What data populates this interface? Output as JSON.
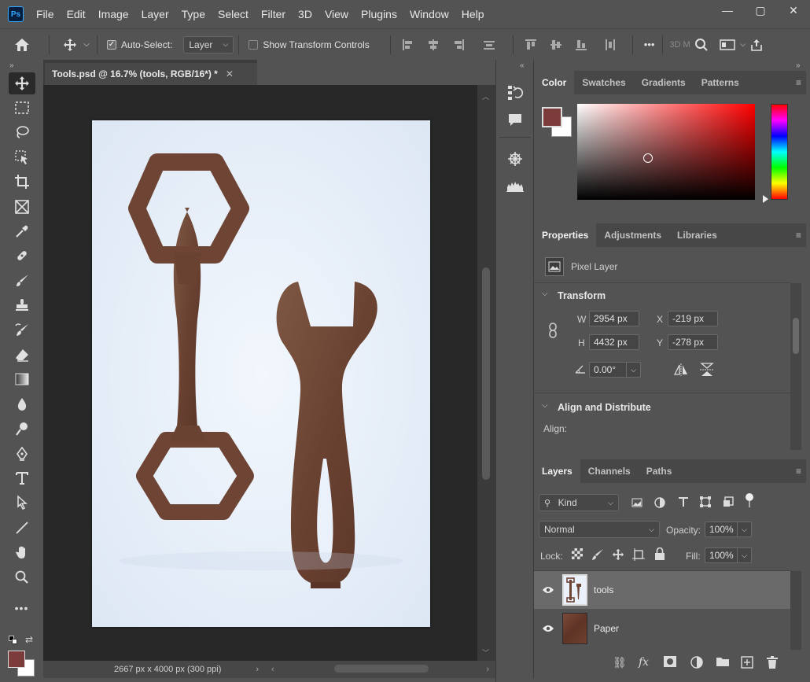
{
  "app": {
    "logo": "Ps"
  },
  "menu": [
    "File",
    "Edit",
    "Image",
    "Layer",
    "Type",
    "Select",
    "Filter",
    "3D",
    "View",
    "Plugins",
    "Window",
    "Help"
  ],
  "window_controls": {
    "minimize": "—",
    "maximize": "▢",
    "close": "✕"
  },
  "options_bar": {
    "auto_select_label": "Auto-Select:",
    "auto_select_value": "Layer",
    "show_transform_label": "Show Transform Controls",
    "more": "•••",
    "mode_3d": "3D M"
  },
  "document_tab": {
    "title": "Tools.psd @ 16.7% (tools, RGB/16*) *",
    "close": "✕"
  },
  "status": {
    "dimensions": "2667 px x 4000 px (300 ppi)"
  },
  "color_panel": {
    "tabs": [
      "Color",
      "Swatches",
      "Gradients",
      "Patterns"
    ],
    "foreground": "#7d3c3c",
    "background": "#ffffff",
    "hue": "#ff0000"
  },
  "properties_panel": {
    "tabs": [
      "Properties",
      "Adjustments",
      "Libraries"
    ],
    "layer_type": "Pixel Layer",
    "transform_title": "Transform",
    "w_label": "W",
    "w_value": "2954 px",
    "h_label": "H",
    "h_value": "4432 px",
    "x_label": "X",
    "x_value": "-219 px",
    "y_label": "Y",
    "y_value": "-278 px",
    "angle_value": "0.00°",
    "align_title": "Align and Distribute",
    "align_label": "Align:"
  },
  "layers_panel": {
    "tabs": [
      "Layers",
      "Channels",
      "Paths"
    ],
    "filter_kind": "Kind",
    "blend_mode": "Normal",
    "opacity_label": "Opacity:",
    "opacity_value": "100%",
    "lock_label": "Lock:",
    "fill_label": "Fill:",
    "fill_value": "100%",
    "layers": [
      {
        "name": "tools",
        "selected": true
      },
      {
        "name": "Paper",
        "selected": false
      }
    ]
  }
}
